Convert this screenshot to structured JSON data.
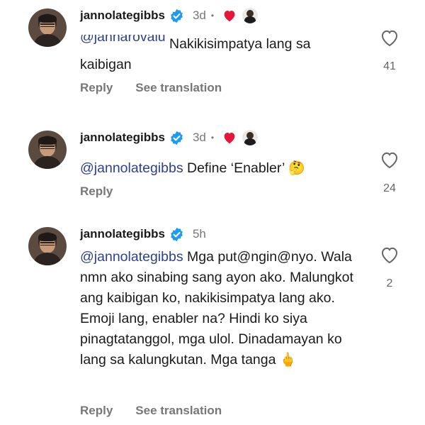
{
  "comments": [
    {
      "username": "jannolategibbs",
      "time": "3d",
      "dot": "•",
      "mention_partial": "@jannarovalu",
      "text": "Nakikisimpatya lang sa kaibigan",
      "reply": "Reply",
      "translate": "See translation",
      "likes": "41",
      "liked_by_creator": true
    },
    {
      "username": "jannolategibbs",
      "time": "3d",
      "dot": "•",
      "mention": "@jannolategibbs",
      "text": "Define ‘Enabler’",
      "emoji": "🤔",
      "reply": "Reply",
      "likes": "24",
      "liked_by_creator": true
    },
    {
      "username": "jannolategibbs",
      "time": "5h",
      "mention": "@jannolategibbs",
      "text": "Mga put@ngin@nyo. Wala nmn ako sinabing sang ayon ako. Malungkot ang kaibigan ko, nakikisimpatya lang ako. Emoji lang, enabler na? Hindi ko siya pinagtatanggol, mga ulol. Dinadamayan ko lang sa kalungkutan. Mga tanga",
      "emoji": "🖕",
      "reply": "Reply",
      "translate": "See translation",
      "likes": "2"
    }
  ],
  "colors": {
    "mention": "#2f3f8f",
    "heart": "#e8173a",
    "verified": "#1d9bf0",
    "meta": "#777777"
  }
}
